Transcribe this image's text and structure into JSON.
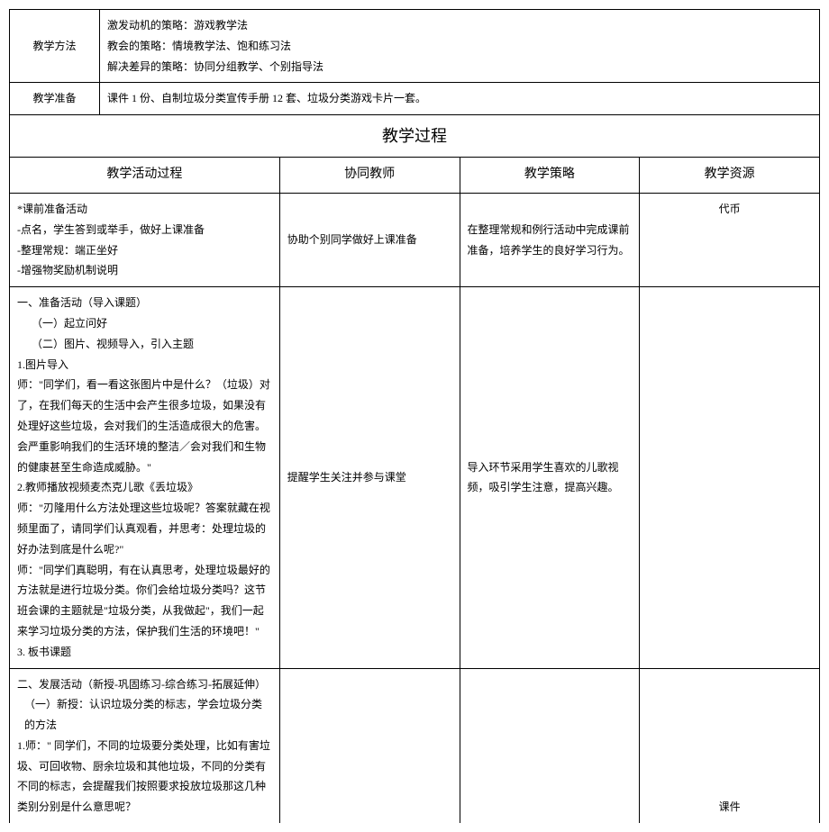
{
  "row1": {
    "label": "教学方法",
    "content": "激发动机的策略：游戏教学法\n教会的策略：情境教学法、饱和练习法\n解决差异的策略：协同分组教学、个别指导法"
  },
  "row2": {
    "label": "教学准备",
    "content": "课件 1 份、自制垃圾分类宣传手册 12 套、垃圾分类游戏卡片一套。"
  },
  "section_title": "教学过程",
  "headers": {
    "activity": "教学活动过程",
    "teacher": "协同教师",
    "strategy": "教学策略",
    "resource": "教学资源"
  },
  "pre_activity": {
    "title": "*课前准备活动",
    "line1": "-点名，学生答到或举手，做好上课准备",
    "line2": "-整理常规：端正坐好",
    "line3": "-增强物奖励机制说明",
    "teacher": "协助个别同学做好上课准备",
    "strategy": "在整理常规和例行活动中完成课前准备，培养学生的良好学习行为。",
    "resource": "代币"
  },
  "prep_activity": {
    "h1": "一、准备活动（导入课题）",
    "h1a": "（一）起立问好",
    "h1b": "（二）图片、视频导入，引入主题",
    "h2": "1.图片导入",
    "p1": "师：\"同学们，看一看这张图片中是什么？（垃圾）对了，在我们每天的生活中会产生很多垃圾，如果没有处理好这些垃圾，会对我们的生活造成很大的危害。会严重影响我们的生活环境的整洁／会对我们和生物的健康甚至生命造成威胁。\"",
    "p2": "2.教师播放视频麦杰克儿歌《丢垃圾》",
    "p3": "师：\"刃隆用什么方法处理这些垃圾呢？答案就藏在视频里面了，请同学们认真观看，并思考：处理垃圾的好办法到底是什么呢?\"",
    "p4": "师：\"同学们真聪明，有在认真思考，处理垃圾最好的方法就是进行垃圾分类。你们会给垃圾分类吗？这节班会课的主题就是\"垃圾分类，从我做起\"，我们一起来学习垃圾分类的方法，保护我们生活的环境吧！\"",
    "p5": "3. 板书课题",
    "teacher": "提醒学生关注并参与课堂",
    "strategy": "导入环节采用学生喜欢的儿歌视频，吸引学生注意，提高兴趣。",
    "resource": ""
  },
  "dev_activity": {
    "h1": "二、发展活动（新授-巩固练习-综合练习-拓展延伸）",
    "h1a": "（一）新授：认识垃圾分类的标志，学会垃圾分类的方法",
    "p1": "1.师：\" 同学们，不同的垃圾要分类处理，比如有害垃圾、可回收物、厨余垃圾和其他垃圾，不同的分类有不同的标志，会提醒我们按照要求投放垃圾那这几种类别分别是什么意思呢？",
    "resource": "课件"
  }
}
